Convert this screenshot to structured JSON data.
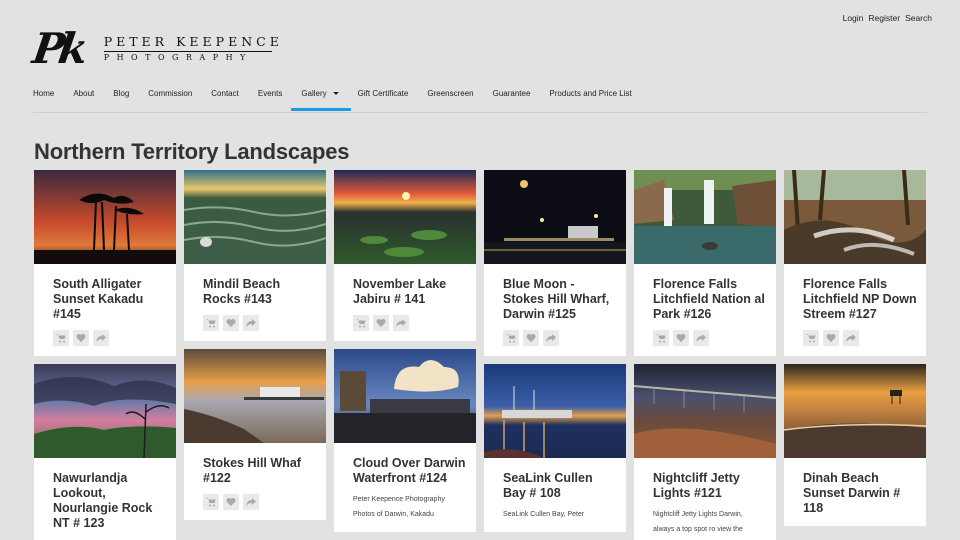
{
  "header": {
    "top_links": [
      "Login",
      "Register",
      "Search"
    ],
    "logo": {
      "mark": "Pk",
      "name": "PETER KEEPENCE",
      "sub": "PHOTOGRAPHY"
    }
  },
  "nav": {
    "items": [
      "Home",
      "About",
      "Blog",
      "Commission",
      "Contact",
      "Events",
      "Gallery",
      "Gift Certificate",
      "Greenscreen",
      "Guarantee",
      "Products and Price List"
    ],
    "active": "Gallery"
  },
  "page": {
    "title": "Northern Territory Landscapes"
  },
  "cards": [
    {
      "title": "South Alligater Sunset Kakadu #145",
      "actions": true
    },
    {
      "title": "Mindil Beach Rocks #143",
      "actions": true
    },
    {
      "title": "November Lake Jabiru # 141",
      "actions": true
    },
    {
      "title": "Blue Moon - Stokes Hill Wharf, Darwin #125",
      "actions": true
    },
    {
      "title": "Florence Falls Litchfield Nation al Park #126",
      "actions": true
    },
    {
      "title": "Florence Falls Litchfield NP Down Streem #127",
      "actions": true
    },
    {
      "title": "Nawurlandja Lookout, Nourlangie Rock NT # 123",
      "actions": false
    },
    {
      "title": "Stokes Hill Whaf #122",
      "actions": true
    },
    {
      "title": "Cloud Over Darwin Waterfront #124",
      "actions": false,
      "desc": [
        "Peter Keepence Photography",
        "Photos of Darwin, Kakadu"
      ]
    },
    {
      "title": "SeaLink Cullen Bay # 108",
      "actions": false,
      "desc": [
        "SeaLink Cullen Bay, Peter"
      ]
    },
    {
      "title": "Nightcliff Jetty Lights #121",
      "actions": false,
      "desc": [
        "Nightcliff Jetty Lights Darwin,",
        "always a top spot ro view the"
      ]
    },
    {
      "title": "Dinah Beach Sunset Darwin # 118",
      "actions": false
    }
  ]
}
